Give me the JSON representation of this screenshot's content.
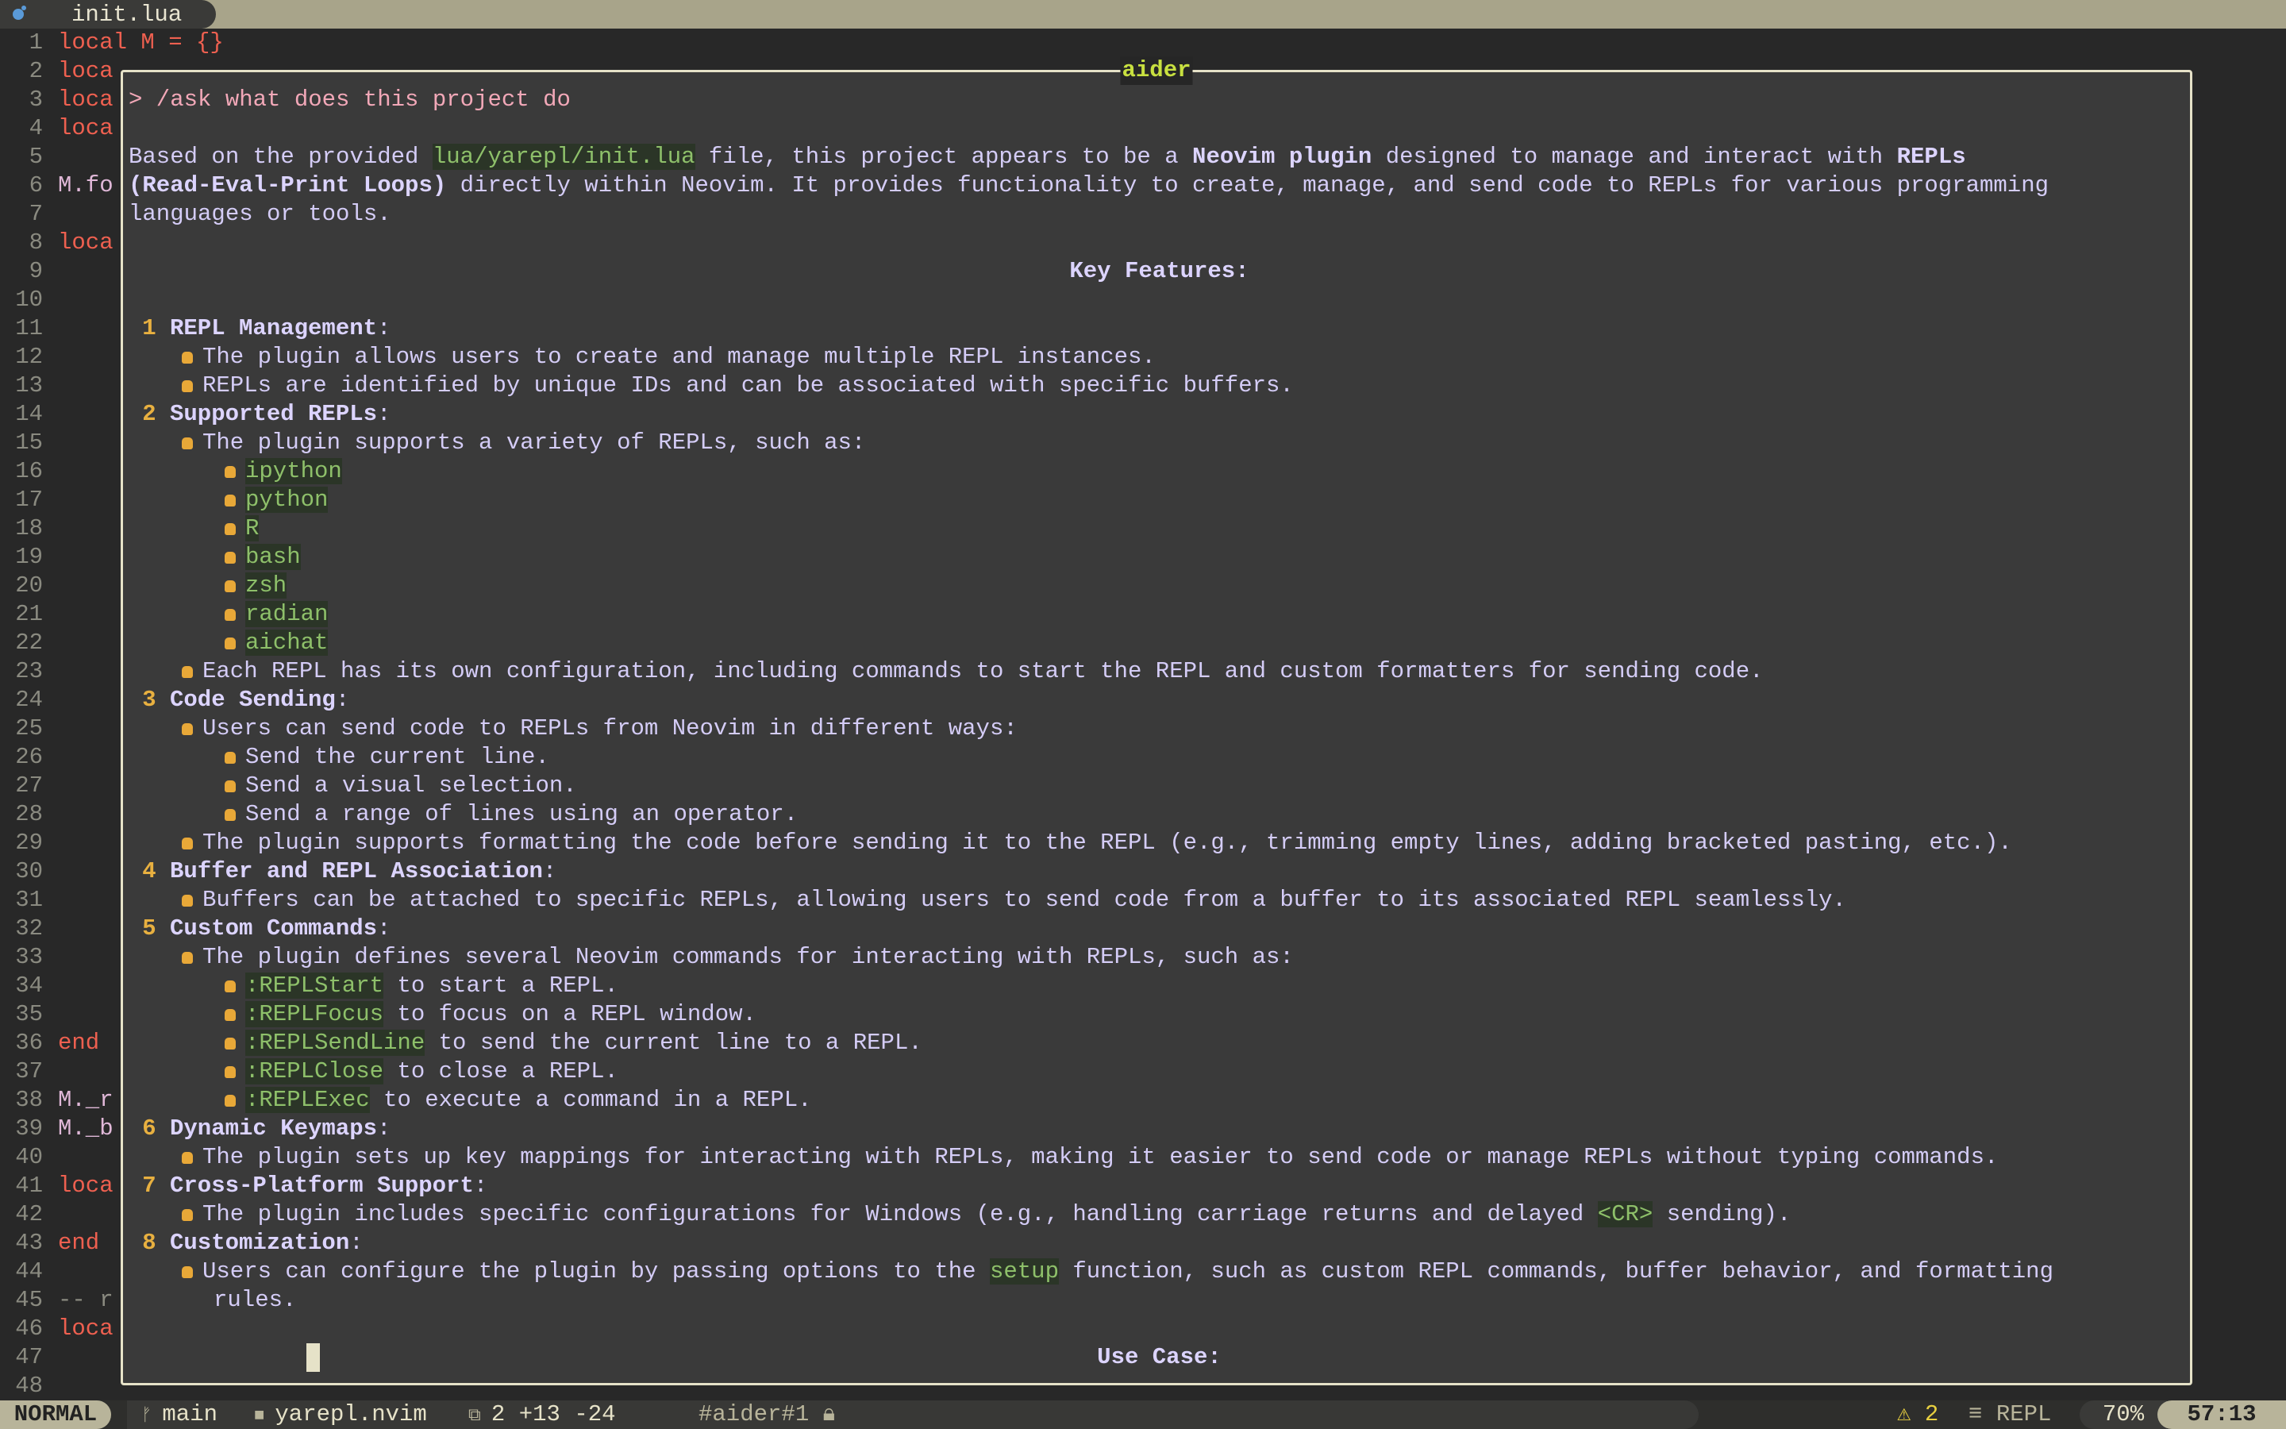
{
  "tabline": {
    "icon": "lua-icon",
    "file": "init.lua"
  },
  "gutter": [
    {
      "n": "1",
      "code": "local M = {}"
    },
    {
      "n": "2",
      "code": "loca"
    },
    {
      "n": "3",
      "code": "loca"
    },
    {
      "n": "4",
      "code": "loca"
    },
    {
      "n": "5",
      "code": ""
    },
    {
      "n": "6",
      "code": "M.fo",
      "k": "m"
    },
    {
      "n": "7",
      "code": ""
    },
    {
      "n": "8",
      "code": "loca"
    },
    {
      "n": "9",
      "code": ""
    },
    {
      "n": "10",
      "code": ""
    },
    {
      "n": "11",
      "code": ""
    },
    {
      "n": "12",
      "code": ""
    },
    {
      "n": "13",
      "code": ""
    },
    {
      "n": "14",
      "code": ""
    },
    {
      "n": "15",
      "code": ""
    },
    {
      "n": "16",
      "code": ""
    },
    {
      "n": "17",
      "code": ""
    },
    {
      "n": "18",
      "code": ""
    },
    {
      "n": "19",
      "code": ""
    },
    {
      "n": "20",
      "code": ""
    },
    {
      "n": "21",
      "code": ""
    },
    {
      "n": "22",
      "code": ""
    },
    {
      "n": "23",
      "code": ""
    },
    {
      "n": "24",
      "code": ""
    },
    {
      "n": "25",
      "code": ""
    },
    {
      "n": "26",
      "code": ""
    },
    {
      "n": "27",
      "code": ""
    },
    {
      "n": "28",
      "code": ""
    },
    {
      "n": "29",
      "code": ""
    },
    {
      "n": "30",
      "code": ""
    },
    {
      "n": "31",
      "code": ""
    },
    {
      "n": "32",
      "code": ""
    },
    {
      "n": "33",
      "code": ""
    },
    {
      "n": "34",
      "code": ""
    },
    {
      "n": "35",
      "code": ""
    },
    {
      "n": "36",
      "code": "end"
    },
    {
      "n": "37",
      "code": ""
    },
    {
      "n": "38",
      "code": "M._r",
      "k": "m"
    },
    {
      "n": "39",
      "code": "M._b",
      "k": "m"
    },
    {
      "n": "40",
      "code": ""
    },
    {
      "n": "41",
      "code": "loca"
    },
    {
      "n": "42",
      "code": ""
    },
    {
      "n": "43",
      "code": "end"
    },
    {
      "n": "44",
      "code": ""
    },
    {
      "n": "45",
      "code": "-- r",
      "k": "cm"
    },
    {
      "n": "46",
      "code": "loca"
    },
    {
      "n": "47",
      "code": ""
    },
    {
      "n": "48",
      "code": ""
    }
  ],
  "float": {
    "title": "aider",
    "rows": [
      {
        "segs": [
          [
            "p",
            "> /ask what does this project do"
          ]
        ]
      },
      {
        "segs": []
      },
      {
        "segs": [
          [
            "n",
            "Based on the provided "
          ],
          [
            "c",
            "lua/yarepl/init.lua"
          ],
          [
            "n",
            " file, this project appears to be a "
          ],
          [
            "b",
            "Neovim plugin"
          ],
          [
            "n",
            " designed to manage and interact with "
          ],
          [
            "b",
            "REPLs"
          ]
        ]
      },
      {
        "segs": [
          [
            "b",
            "(Read-Eval-Print Loops)"
          ],
          [
            "n",
            " directly within Neovim. It provides functionality to create, manage, and send code to REPLs for various programming"
          ]
        ]
      },
      {
        "segs": [
          [
            "n",
            "languages or tools."
          ]
        ]
      },
      {
        "segs": []
      },
      {
        "center": true,
        "segs": [
          [
            "b",
            "Key Features:"
          ]
        ]
      },
      {
        "segs": []
      },
      {
        "num": "1",
        "segs": [
          [
            "b",
            "REPL Management"
          ],
          [
            "n",
            ":"
          ]
        ]
      },
      {
        "bullet": 1,
        "segs": [
          [
            "n",
            "The plugin allows users to create and manage multiple REPL instances."
          ]
        ]
      },
      {
        "bullet": 1,
        "segs": [
          [
            "n",
            "REPLs are identified by unique IDs and can be associated with specific buffers."
          ]
        ]
      },
      {
        "num": "2",
        "segs": [
          [
            "b",
            "Supported REPLs"
          ],
          [
            "n",
            ":"
          ]
        ]
      },
      {
        "bullet": 1,
        "segs": [
          [
            "n",
            "The plugin supports a variety of REPLs, such as:"
          ]
        ]
      },
      {
        "bullet": 2,
        "segs": [
          [
            "c",
            "ipython"
          ]
        ]
      },
      {
        "bullet": 2,
        "segs": [
          [
            "c",
            "python"
          ]
        ]
      },
      {
        "bullet": 2,
        "segs": [
          [
            "c",
            "R"
          ]
        ]
      },
      {
        "bullet": 2,
        "segs": [
          [
            "c",
            "bash"
          ]
        ]
      },
      {
        "bullet": 2,
        "segs": [
          [
            "c",
            "zsh"
          ]
        ]
      },
      {
        "bullet": 2,
        "segs": [
          [
            "c",
            "radian"
          ]
        ]
      },
      {
        "bullet": 2,
        "segs": [
          [
            "c",
            "aichat"
          ]
        ]
      },
      {
        "bullet": 1,
        "segs": [
          [
            "n",
            "Each REPL has its own configuration, including commands to start the REPL and custom formatters for sending code."
          ]
        ]
      },
      {
        "num": "3",
        "segs": [
          [
            "b",
            "Code Sending"
          ],
          [
            "n",
            ":"
          ]
        ]
      },
      {
        "bullet": 1,
        "segs": [
          [
            "n",
            "Users can send code to REPLs from Neovim in different ways:"
          ]
        ]
      },
      {
        "bullet": 2,
        "segs": [
          [
            "n",
            "Send the current line."
          ]
        ]
      },
      {
        "bullet": 2,
        "segs": [
          [
            "n",
            "Send a visual selection."
          ]
        ]
      },
      {
        "bullet": 2,
        "segs": [
          [
            "n",
            "Send a range of lines using an operator."
          ]
        ]
      },
      {
        "bullet": 1,
        "segs": [
          [
            "n",
            "The plugin supports formatting the code before sending it to the REPL (e.g., trimming empty lines, adding bracketed pasting, etc.)."
          ]
        ]
      },
      {
        "num": "4",
        "segs": [
          [
            "b",
            "Buffer and REPL Association"
          ],
          [
            "n",
            ":"
          ]
        ]
      },
      {
        "bullet": 1,
        "segs": [
          [
            "n",
            "Buffers can be attached to specific REPLs, allowing users to send code from a buffer to its associated REPL seamlessly."
          ]
        ]
      },
      {
        "num": "5",
        "segs": [
          [
            "b",
            "Custom Commands"
          ],
          [
            "n",
            ":"
          ]
        ]
      },
      {
        "bullet": 1,
        "segs": [
          [
            "n",
            "The plugin defines several Neovim commands for interacting with REPLs, such as:"
          ]
        ]
      },
      {
        "bullet": 2,
        "segs": [
          [
            "c",
            ":REPLStart"
          ],
          [
            "n",
            " to start a REPL."
          ]
        ]
      },
      {
        "bullet": 2,
        "segs": [
          [
            "c",
            ":REPLFocus"
          ],
          [
            "n",
            " to focus on a REPL window."
          ]
        ]
      },
      {
        "bullet": 2,
        "segs": [
          [
            "c",
            ":REPLSendLine"
          ],
          [
            "n",
            " to send the current line to a REPL."
          ]
        ]
      },
      {
        "bullet": 2,
        "segs": [
          [
            "c",
            ":REPLClose"
          ],
          [
            "n",
            " to close a REPL."
          ]
        ]
      },
      {
        "bullet": 2,
        "segs": [
          [
            "c",
            ":REPLExec"
          ],
          [
            "n",
            " to execute a command in a REPL."
          ]
        ]
      },
      {
        "num": "6",
        "segs": [
          [
            "b",
            "Dynamic Keymaps"
          ],
          [
            "n",
            ":"
          ]
        ]
      },
      {
        "bullet": 1,
        "segs": [
          [
            "n",
            "The plugin sets up key mappings for interacting with REPLs, making it easier to send code or manage REPLs without typing commands."
          ]
        ]
      },
      {
        "num": "7",
        "segs": [
          [
            "b",
            "Cross-Platform Support"
          ],
          [
            "n",
            ":"
          ]
        ]
      },
      {
        "bullet": 1,
        "segs": [
          [
            "n",
            "The plugin includes specific configurations for Windows (e.g., handling carriage returns and delayed "
          ],
          [
            "c",
            "<CR>"
          ],
          [
            "n",
            " sending)."
          ]
        ]
      },
      {
        "num": "8",
        "segs": [
          [
            "b",
            "Customization"
          ],
          [
            "n",
            ":"
          ]
        ]
      },
      {
        "bullet": 1,
        "segs": [
          [
            "n",
            "Users can configure the plugin by passing options to the "
          ],
          [
            "c",
            "setup"
          ],
          [
            "n",
            " function, such as custom REPL commands, buffer behavior, and formatting"
          ]
        ]
      },
      {
        "cont": true,
        "segs": [
          [
            "n",
            "rules."
          ]
        ]
      },
      {
        "segs": []
      },
      {
        "center": true,
        "cursor": true,
        "segs": [
          [
            "b",
            "Use Case:"
          ]
        ]
      }
    ]
  },
  "status": {
    "mode": "NORMAL",
    "branch": "main",
    "project": "yarepl.nvim",
    "git_changes": "2",
    "git_added": "+13",
    "git_removed": "-24",
    "terminal": "#aider#1",
    "warnings": "2",
    "filetype": "REPL",
    "percent": "70%",
    "position": "57:13"
  },
  "colors": {
    "accent": "#c8e040",
    "border": "#e6e2c8",
    "bullet": "#e8a838",
    "code": "#8ec06a",
    "text": "#d4ccf6",
    "keyword": "#ee6050"
  }
}
